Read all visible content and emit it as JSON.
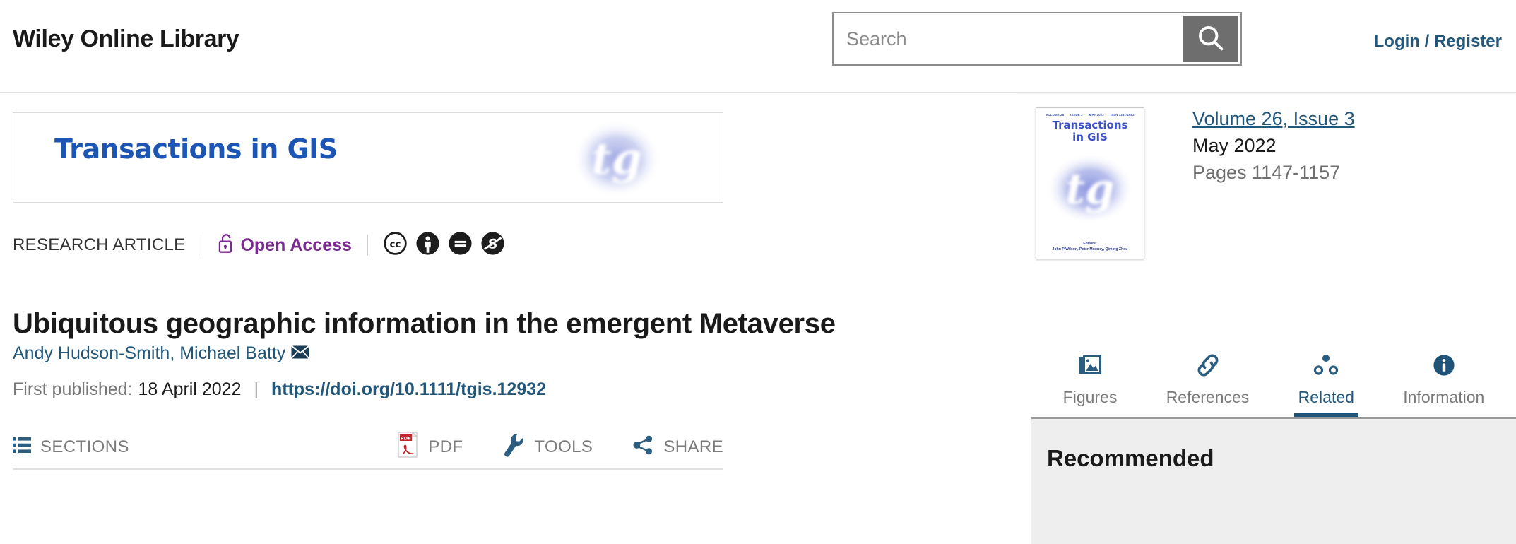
{
  "header": {
    "brand": "Wiley Online Library",
    "search": {
      "placeholder": "Search",
      "value": "",
      "icon": "search-icon"
    },
    "login_label": "Login / Register"
  },
  "journal_banner": {
    "title": "Transactions in GIS",
    "logo": "tg-journal-logo"
  },
  "article": {
    "type": "RESEARCH ARTICLE",
    "access_label": "Open Access",
    "access_icon": "open-lock-icon",
    "license_icons": [
      "cc-icon",
      "cc-by-icon",
      "cc-nd-icon",
      "cc-nc-icon"
    ],
    "title": "Ubiquitous geographic information in the emergent Metaverse",
    "authors": "Andy Hudson-Smith, Michael Batty",
    "corresponding_icon": "envelope-icon",
    "first_published_label": "First published:",
    "first_published_date": "18 April 2022",
    "separator": "|",
    "doi": "https://doi.org/10.1111/tgis.12932"
  },
  "toolbar": {
    "sections_label": "SECTIONS",
    "sections_icon": "list-icon",
    "pdf_label": "PDF",
    "pdf_icon": "pdf-icon",
    "tools_label": "TOOLS",
    "tools_icon": "wrench-icon",
    "share_label": "SHARE",
    "share_icon": "share-nodes-icon"
  },
  "issue": {
    "cover": {
      "masthead": [
        "VOLUME 26",
        "ISSUE 3",
        "MAY 2022",
        "ISSN 1361-1682"
      ],
      "title_line1": "Transactions",
      "title_line2": "in GIS",
      "editors_label": "Editors:",
      "editors_names": "John P Wilson, Peter Mooney, Qiming Zhou"
    },
    "volume_label": "Volume",
    "volume_number": "26",
    "issue_label": "Issue",
    "issue_number": "3",
    "volume_line": "Volume 26, Issue 3",
    "date": "May 2022",
    "pages": "Pages 1147-1157"
  },
  "tabs": [
    {
      "label": "Figures",
      "icon": "figures-icon",
      "active": false
    },
    {
      "label": "References",
      "icon": "link-icon",
      "active": false
    },
    {
      "label": "Related",
      "icon": "related-nodes-icon",
      "active": true
    },
    {
      "label": "Information",
      "icon": "info-icon",
      "active": false
    }
  ],
  "recommended": {
    "title": "Recommended"
  },
  "colors": {
    "link_blue": "#22577a",
    "accent_blue": "#1f5478",
    "open_access_purple": "#7a2b8f",
    "journal_blue": "#1d55b4",
    "pdf_red": "#c1272d",
    "panel_grey": "#eeeeee"
  }
}
